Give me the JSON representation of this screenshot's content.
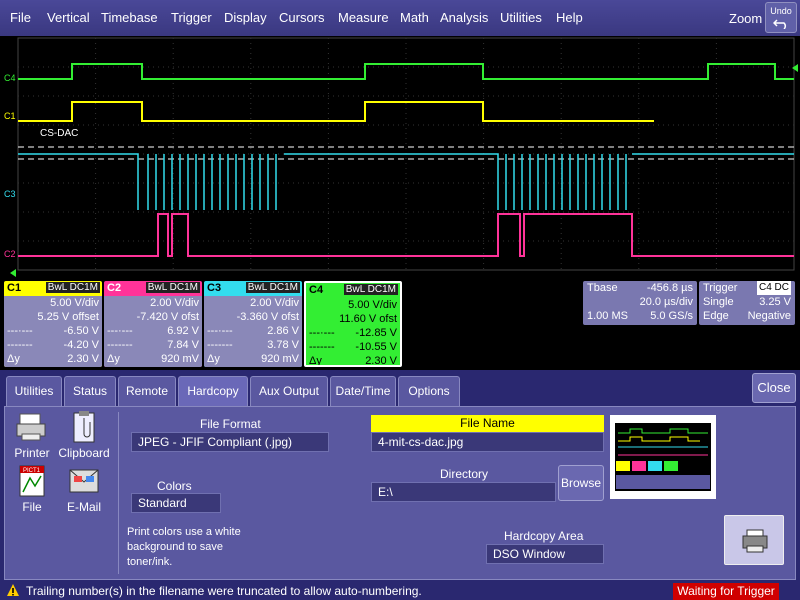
{
  "menu": [
    "File",
    "Vertical",
    "Timebase",
    "Trigger",
    "Display",
    "Cursors",
    "Measure",
    "Math",
    "Analysis",
    "Utilities",
    "Help"
  ],
  "zoom_label": "Zoom",
  "undo_label": "Undo",
  "colors": {
    "c1": "#ffff00",
    "c2": "#ff3399",
    "c3": "#33ddee",
    "c4": "#33ee33"
  },
  "grid": {
    "labels": {
      "c4": "C4",
      "c1": "C1",
      "c3": "C3",
      "c2": "C2",
      "annotation": "CS-DAC"
    }
  },
  "channels": [
    {
      "id": "C1",
      "tags": "BwL DC1M",
      "vdiv": "5.00 V/div",
      "offset": "5.25 V offset",
      "r1": "-6.50 V",
      "r2": "-4.20 V",
      "dy_label": "Δy",
      "dy": "2.30 V"
    },
    {
      "id": "C2",
      "tags": "BwL DC1M",
      "vdiv": "2.00 V/div",
      "offset": "-7.420 V ofst",
      "r1": "6.92 V",
      "r2": "7.84 V",
      "dy_label": "Δy",
      "dy": "920 mV"
    },
    {
      "id": "C3",
      "tags": "BwL DC1M",
      "vdiv": "2.00 V/div",
      "offset": "-3.360 V ofst",
      "r1": "2.86 V",
      "r2": "3.78 V",
      "dy_label": "Δy",
      "dy": "920 mV"
    },
    {
      "id": "C4",
      "tags": "BwL DC1M",
      "vdiv": "5.00 V/div",
      "offset": "11.60 V ofst",
      "r1": "-12.85 V",
      "r2": "-10.55 V",
      "dy_label": "Δy",
      "dy": "2.30 V"
    }
  ],
  "timebase": {
    "label": "Tbase",
    "delay": "-456.8 µs",
    "tdiv": "20.0 µs/div",
    "samples": "1.00 MS",
    "rate": "5.0 GS/s"
  },
  "trigger": {
    "label": "Trigger",
    "source": "C4",
    "coupling": "DC",
    "mode": "Single",
    "level": "3.25 V",
    "type": "Edge",
    "slope": "Negative"
  },
  "tabs": [
    "Utilities",
    "Status",
    "Remote",
    "Hardcopy",
    "Aux Output",
    "Date/Time",
    "Options"
  ],
  "active_tab": "Hardcopy",
  "close_label": "Close",
  "hardcopy": {
    "icons": [
      {
        "label": "Printer"
      },
      {
        "label": "Clipboard"
      },
      {
        "label": "File"
      },
      {
        "label": "E-Mail"
      }
    ],
    "file_format_label": "File Format",
    "file_format_value": "JPEG - JFIF Compliant (.jpg)",
    "colors_label": "Colors",
    "colors_value": "Standard",
    "print_note": "Print colors use a white background to save toner/ink.",
    "file_name_label": "File Name",
    "file_name_value": "4-mit-cs-dac.jpg",
    "directory_label": "Directory",
    "directory_value": "E:\\",
    "browse_label": "Browse",
    "hardcopy_area_label": "Hardcopy Area",
    "hardcopy_area_value": "DSO Window",
    "icon_pict_label": "PICT1"
  },
  "status": {
    "message": "Trailing number(s) in the filename were truncated to allow auto-numbering.",
    "trigger_state": "Waiting for Trigger"
  }
}
